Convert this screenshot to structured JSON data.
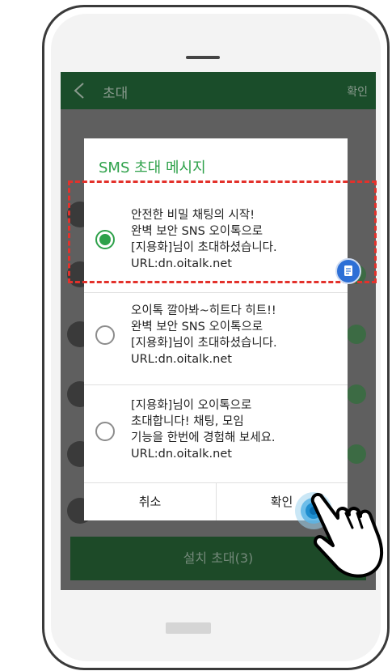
{
  "header": {
    "title": "초대",
    "confirm": "확인"
  },
  "dialog": {
    "title": "SMS 초대 메시지",
    "options": [
      {
        "lines": [
          "안전한 비밀 채팅의 시작!",
          "완벽 보안 SNS 오이톡으로",
          "[지용화]님이 초대하셨습니다.",
          "URL:dn.oitalk.net"
        ],
        "selected": true
      },
      {
        "lines": [
          "오이톡 깔아봐~히트다 히트!!",
          "완벽 보안 SNS 오이톡으로",
          "[지용화]님이 초대하셨습니다.",
          "URL:dn.oitalk.net"
        ],
        "selected": false
      },
      {
        "lines": [
          "[지용화]님이 오이톡으로",
          "초대합니다! 채팅, 모임",
          "기능을 한번에 경험해 보세요.",
          "URL:dn.oitalk.net"
        ],
        "selected": false
      }
    ],
    "cancel": "취소",
    "ok": "확인"
  },
  "install_button": "설치 초대(3)",
  "colors": {
    "accent": "#2ea14a",
    "header_bg": "#1a4d2a",
    "highlight": "#e3312b",
    "fab": "#2d6fd6"
  },
  "icons": [
    "back-icon",
    "copy-icon",
    "tap-indicator-icon",
    "pointing-hand-icon"
  ]
}
